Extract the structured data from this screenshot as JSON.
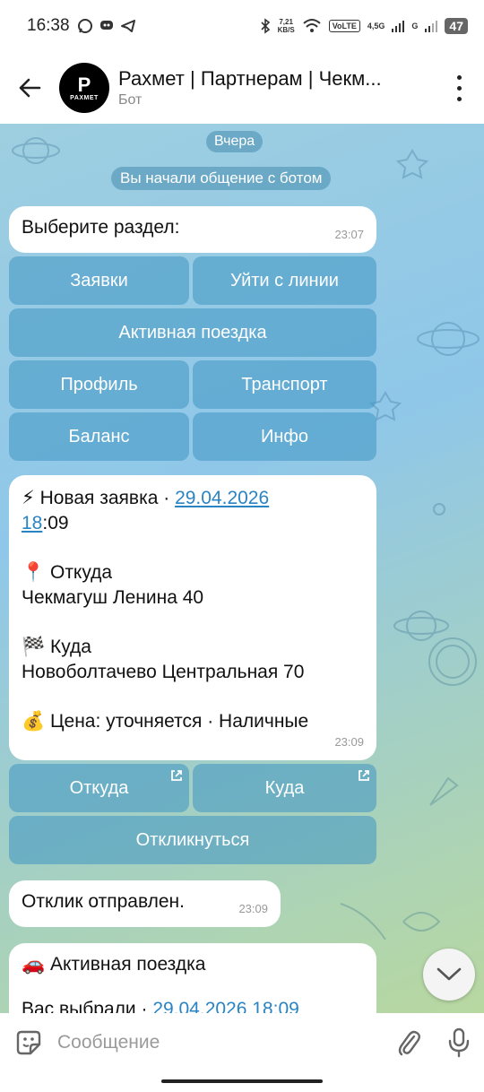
{
  "status_bar": {
    "time": "16:38",
    "net_speed_top": "7,21",
    "net_speed_bottom": "KB/S",
    "volte": "VoLTE",
    "net1": "4,5G",
    "net2": "G",
    "battery": "47"
  },
  "header": {
    "title": "Рахмет | Партнерам | Чекм...",
    "subtitle": "Бот",
    "avatar_p": "P",
    "avatar_text": "PAXMET"
  },
  "chat": {
    "date_pill": "Вчера",
    "service_message": "Вы начали общение с ботом",
    "messages": [
      {
        "text": "Выберите раздел:",
        "time": "23:07"
      },
      {
        "lines": {
          "l1_prefix": "⚡ Новая заявка · ",
          "l1_link": "29.04.2026",
          "l2_link": "18",
          "l2_rest": ":09",
          "from_label": "📍 Откуда",
          "from_value": "Чекмагуш Ленина 40",
          "to_label": "🏁 Куда",
          "to_value": "Новоболтачево Центральная 70",
          "price": "💰 Цена: уточняется · Наличные"
        },
        "time": "23:09"
      },
      {
        "text": "Отклик отправлен.",
        "time": "23:09"
      },
      {
        "title": "🚗 Активная поездка",
        "partial_prefix": "Вас выбрали · ",
        "partial_link": "29.04.2026 18:09"
      }
    ],
    "keyboard1": [
      "Заявки",
      "Уйти с линии",
      "Активная поездка",
      "Профиль",
      "Транспорт",
      "Баланс",
      "Инфо"
    ],
    "keyboard2": [
      "Откуда",
      "Куда",
      "Откликнуться"
    ]
  },
  "input": {
    "placeholder": "Сообщение"
  },
  "colors": {
    "accent": "#2a84c4",
    "keyboard_button": "#4096c3"
  }
}
